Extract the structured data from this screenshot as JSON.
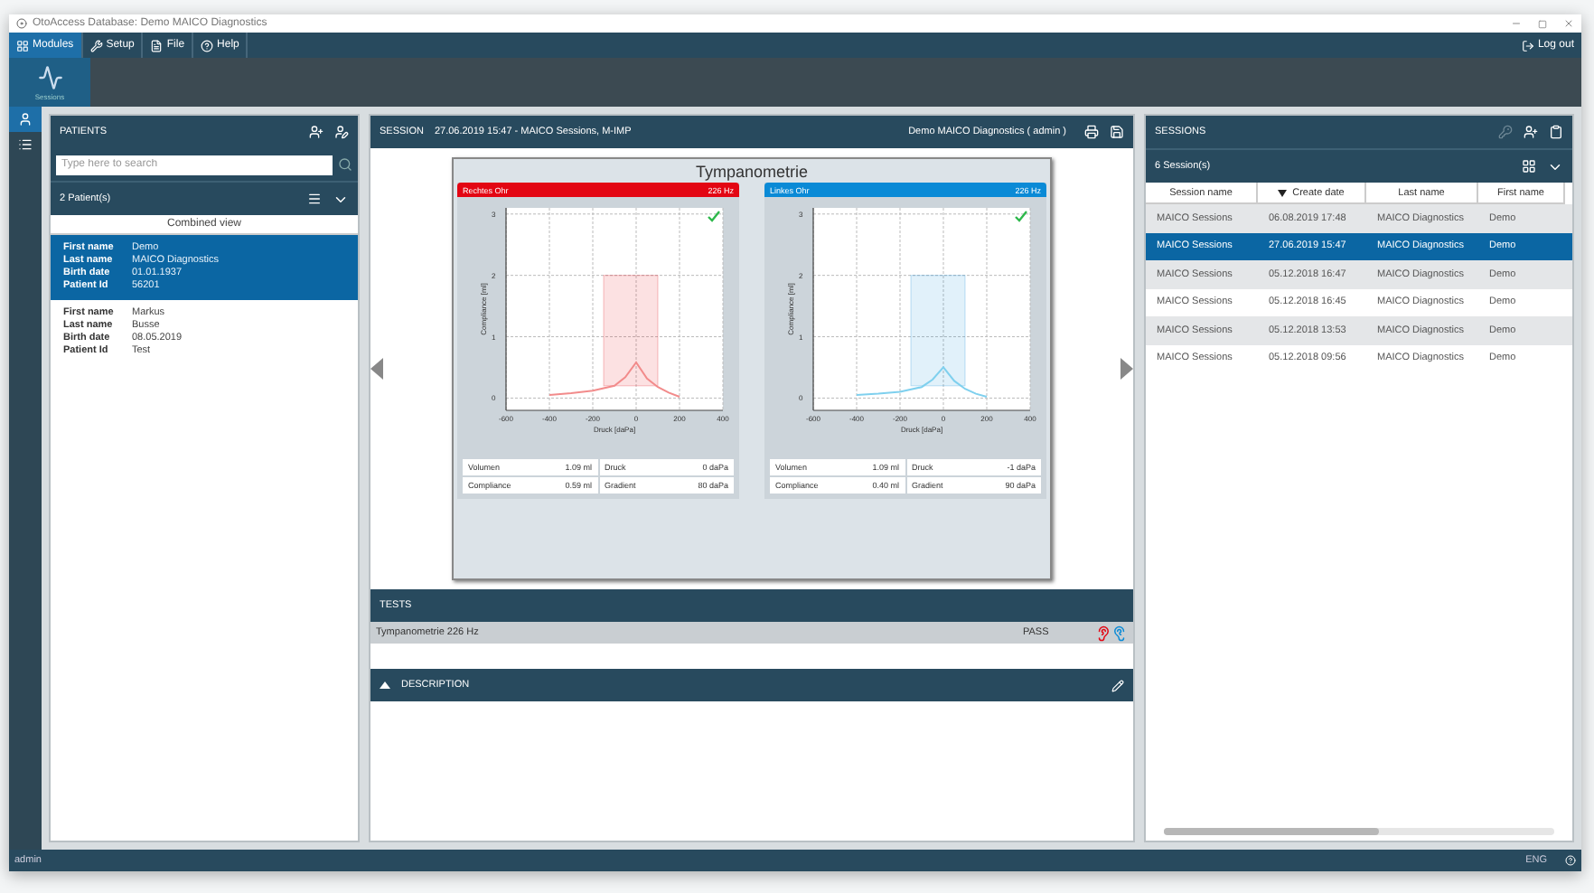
{
  "window": {
    "title": "OtoAccess Database: Demo MAICO Diagnostics"
  },
  "menu": [
    {
      "kind": "modules",
      "label": "Modules",
      "selected": true
    },
    {
      "kind": "setup",
      "label": "Setup",
      "selected": false
    },
    {
      "kind": "file",
      "label": "File",
      "selected": false
    },
    {
      "kind": "help",
      "label": "Help",
      "selected": false
    }
  ],
  "logout": "Log out",
  "modules": [
    {
      "label": "Sessions",
      "selected": true
    }
  ],
  "nav": [
    {
      "kind": "patient",
      "selected": true
    },
    {
      "kind": "list",
      "selected": false
    }
  ],
  "patients": {
    "title": "PATIENTS",
    "search": {
      "placeholder": "Type here to search"
    },
    "count": "2 Patient(s)",
    "view": "Combined view",
    "items": [
      {
        "selected": true,
        "fields": [
          {
            "label": "First name",
            "value": "Demo"
          },
          {
            "label": "Last name",
            "value": "MAICO Diagnostics"
          },
          {
            "label": "Birth date",
            "value": "01.01.1937"
          },
          {
            "label": "Patient Id",
            "value": "56201"
          }
        ]
      },
      {
        "selected": false,
        "fields": [
          {
            "label": "First name",
            "value": "Markus"
          },
          {
            "label": "Last name",
            "value": "Busse"
          },
          {
            "label": "Birth date",
            "value": "08.05.2019"
          },
          {
            "label": "Patient Id",
            "value": "Test"
          }
        ]
      }
    ]
  },
  "session": {
    "title": "SESSION",
    "info": "27.06.2019 15:47 - MAICO Sessions, M-IMP",
    "user": "Demo MAICO Diagnostics ( admin )",
    "report": {
      "title": "Tympanometrie",
      "ears": [
        {
          "label": "Rechtes Ohr",
          "frequency": "226 Hz",
          "color": "#e30613",
          "pass": true,
          "chart_data": {
            "type": "line",
            "xlabel": "Druck [daPa]",
            "ylabel": "Compliance [ml]",
            "x": [
              -400,
              -300,
              -200,
              -100,
              -50,
              0,
              50,
              100,
              150,
              200
            ],
            "grid": true,
            "series": [
              {
                "color": "#f28b8b",
                "values": [
                  0.05,
                  0.08,
                  0.12,
                  0.2,
                  0.34,
                  0.58,
                  0.32,
                  0.18,
                  0.09,
                  0.02
                ]
              }
            ],
            "xlim": [
              -600,
              400
            ],
            "ylim": [
              -0.2,
              3.1
            ],
            "xticks": [
              -600,
              -400,
              -200,
              0,
              200,
              400
            ],
            "yticks": [
              0,
              1,
              2,
              3
            ]
          },
          "measures": [
            {
              "label": "Volumen",
              "value": "1.09 ml"
            },
            {
              "label": "Druck",
              "value": "0 daPa"
            },
            {
              "label": "Compliance",
              "value": "0.59 ml"
            },
            {
              "label": "Gradient",
              "value": "80 daPa"
            }
          ]
        },
        {
          "label": "Linkes Ohr",
          "frequency": "226 Hz",
          "color": "#0a8ad6",
          "pass": true,
          "chart_data": {
            "type": "line",
            "xlabel": "Druck [daPa]",
            "ylabel": "Compliance [ml]",
            "x": [
              -400,
              -300,
              -200,
              -100,
              -50,
              0,
              50,
              100,
              150,
              200
            ],
            "grid": true,
            "series": [
              {
                "color": "#7fd0ee",
                "values": [
                  0.05,
                  0.07,
                  0.1,
                  0.18,
                  0.3,
                  0.5,
                  0.28,
                  0.15,
                  0.07,
                  0.02
                ]
              }
            ],
            "xlim": [
              -600,
              400
            ],
            "ylim": [
              -0.2,
              3.1
            ],
            "xticks": [
              -600,
              -400,
              -200,
              0,
              200,
              400
            ],
            "yticks": [
              0,
              1,
              2,
              3
            ]
          },
          "measures": [
            {
              "label": "Volumen",
              "value": "1.09 ml"
            },
            {
              "label": "Druck",
              "value": "-1 daPa"
            },
            {
              "label": "Compliance",
              "value": "0.40 ml"
            },
            {
              "label": "Gradient",
              "value": "90 daPa"
            }
          ]
        }
      ]
    },
    "tests": {
      "title": "TESTS",
      "rows": [
        {
          "name": "Tympanometrie 226 Hz",
          "result": "PASS"
        }
      ]
    },
    "description": {
      "title": "DESCRIPTION"
    }
  },
  "sessions": {
    "title": "SESSIONS",
    "count": "6 Session(s)",
    "columns": [
      {
        "label": "Session name",
        "sorted": false
      },
      {
        "label": "Create date",
        "sorted": true
      },
      {
        "label": "Last name",
        "sorted": false
      },
      {
        "label": "First name",
        "sorted": false
      }
    ],
    "rows": [
      {
        "selected": false,
        "cells": [
          "MAICO Sessions",
          "06.08.2019 17:48",
          "MAICO Diagnostics",
          "Demo"
        ]
      },
      {
        "selected": true,
        "cells": [
          "MAICO Sessions",
          "27.06.2019 15:47",
          "MAICO Diagnostics",
          "Demo"
        ]
      },
      {
        "selected": false,
        "cells": [
          "MAICO Sessions",
          "05.12.2018 16:47",
          "MAICO Diagnostics",
          "Demo"
        ]
      },
      {
        "selected": false,
        "cells": [
          "MAICO Sessions",
          "05.12.2018 16:45",
          "MAICO Diagnostics",
          "Demo"
        ]
      },
      {
        "selected": false,
        "cells": [
          "MAICO Sessions",
          "05.12.2018 13:53",
          "MAICO Diagnostics",
          "Demo"
        ]
      },
      {
        "selected": false,
        "cells": [
          "MAICO Sessions",
          "05.12.2018 09:56",
          "MAICO Diagnostics",
          "Demo"
        ]
      }
    ]
  },
  "status_bar": {
    "user": "admin",
    "language": "ENG"
  }
}
